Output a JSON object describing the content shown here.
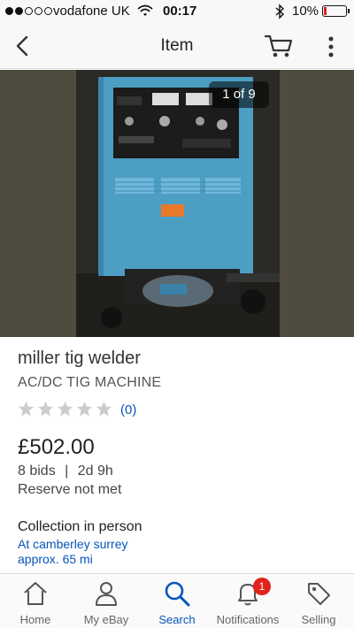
{
  "status_bar": {
    "carrier": "vodafone UK",
    "time": "00:17",
    "battery": "10%"
  },
  "header": {
    "title": "Item",
    "icons": [
      "back-arrow-icon",
      "cart-icon",
      "more-vertical-icon"
    ]
  },
  "gallery": {
    "counter": "1 of 9"
  },
  "item": {
    "title": "miller tig welder",
    "subtitle": "AC/DC TIG MACHINE",
    "rating": 0,
    "max_rating": 5,
    "review_count": "(0)",
    "price": "£502.00",
    "bids": "8 bids",
    "separator": "|",
    "time_left": "2d 9h",
    "reserve": "Reserve not met",
    "collection": "Collection in person",
    "location": "At camberley surrey",
    "distance": "approx. 65 mi"
  },
  "tabbar": {
    "tabs": [
      {
        "label": "Home",
        "icon": "home-icon"
      },
      {
        "label": "My eBay",
        "icon": "user-icon"
      },
      {
        "label": "Search",
        "icon": "search-icon"
      },
      {
        "label": "Notifications",
        "icon": "bell-icon",
        "badge": "1"
      },
      {
        "label": "Selling",
        "icon": "tag-icon"
      }
    ],
    "active": "Search"
  },
  "colors": {
    "accent": "#0654ba",
    "badge": "#e0231c",
    "star_empty": "#cccccc"
  }
}
